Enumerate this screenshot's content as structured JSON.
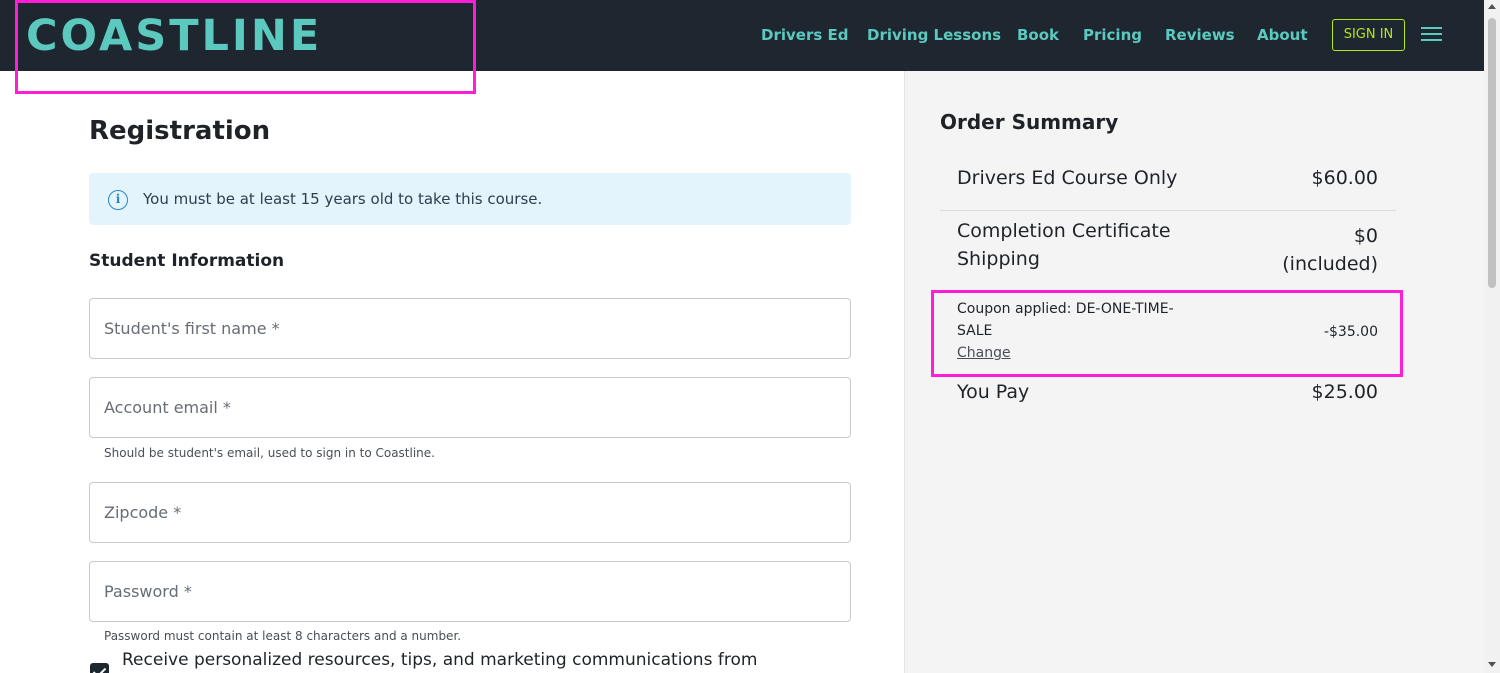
{
  "header": {
    "logo": "COASTLINE",
    "nav": [
      "Drivers Ed",
      "Driving Lessons",
      "Book",
      "Pricing",
      "Reviews",
      "About"
    ],
    "sign_in": "SIGN IN"
  },
  "registration": {
    "title": "Registration",
    "notice": "You must be at least 15 years old to take this course.",
    "section_title": "Student Information",
    "fields": {
      "first_name": {
        "placeholder": "Student's first name *",
        "value": ""
      },
      "email": {
        "placeholder": "Account email *",
        "value": "",
        "helper": "Should be student's email, used to sign in to Coastline."
      },
      "zipcode": {
        "placeholder": "Zipcode *",
        "value": ""
      },
      "password": {
        "placeholder": "Password *",
        "value": "",
        "helper": "Password must contain at least 8 characters and a number."
      }
    },
    "consent": {
      "checked": true,
      "label": "Receive personalized resources, tips, and marketing communications from"
    }
  },
  "order_summary": {
    "title": "Order Summary",
    "items": [
      {
        "label": "Drivers Ed Course Only",
        "value": "$60.00"
      },
      {
        "label_line1": "Completion Certificate",
        "label_line2": "Shipping",
        "value_line1": "$0",
        "value_line2": "(included)"
      }
    ],
    "coupon": {
      "label_line1": "Coupon applied: DE-ONE-TIME-",
      "label_line2": "SALE",
      "change": "Change",
      "value": "-$35.00"
    },
    "total": {
      "label": "You Pay",
      "value": "$25.00"
    }
  },
  "colors": {
    "header_bg": "#1e2630",
    "accent_teal": "#5cc9bf",
    "signin_green": "#b6e51c",
    "highlight_magenta": "#ff1dd8",
    "notice_bg": "#e3f4fc"
  },
  "icons": [
    "info-icon",
    "hamburger-menu-icon",
    "checkbox-checked-icon"
  ]
}
